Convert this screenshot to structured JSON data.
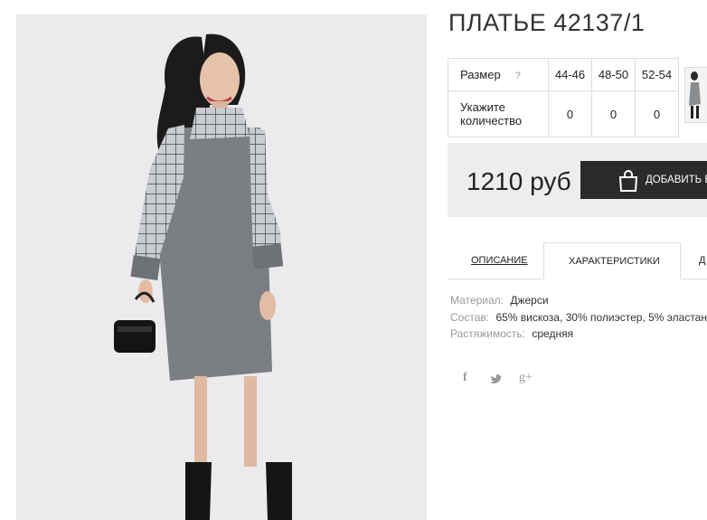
{
  "product": {
    "title": "ПЛАТЬЕ 42137/1"
  },
  "sizes_table": {
    "size_label": "Размер",
    "help_icon": "?",
    "sizes": [
      "44-46",
      "48-50",
      "52-54"
    ],
    "qty_label": "Укажите количество",
    "quantities": [
      "0",
      "0",
      "0"
    ]
  },
  "price": {
    "value": "1210 руб",
    "button_label": "ДОБАВИТЬ В"
  },
  "tabs": [
    {
      "label": "ОПИСАНИЕ"
    },
    {
      "label": "ХАРАКТЕРИСТИКИ",
      "active": true
    },
    {
      "label": "Д"
    }
  ],
  "properties": [
    {
      "key": "Материал:",
      "value": "Джерси"
    },
    {
      "key": "Состав:",
      "value": "65% вискоза, 30% полиэстер, 5% эластан"
    },
    {
      "key": "Растяжимость:",
      "value": "средняя"
    }
  ],
  "social": [
    {
      "icon": "facebook-icon",
      "glyph": "f"
    },
    {
      "icon": "twitter-icon",
      "glyph": "t"
    },
    {
      "icon": "google-plus-icon",
      "glyph": "g+"
    }
  ],
  "colors": {
    "button_bg": "#2b2b2b",
    "price_bg": "#ededed",
    "photo_bg": "#ebebed"
  }
}
